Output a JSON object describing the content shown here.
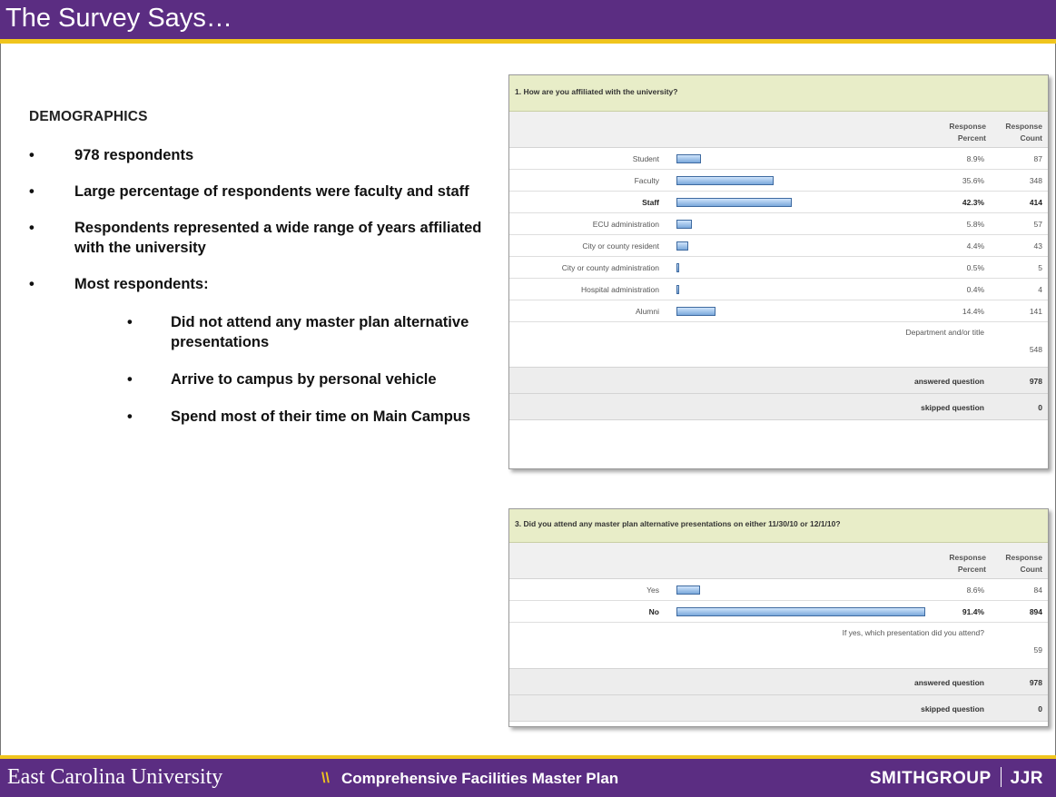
{
  "slide": {
    "title": "The Survey Says…"
  },
  "left": {
    "heading": "DEMOGRAPHICS",
    "bullets": [
      "978 respondents",
      "Large percentage of respondents were faculty and staff",
      "Respondents represented a wide range of years affiliated with the university",
      "Most respondents:"
    ],
    "sub_bullets": [
      "Did not attend any master plan alternative presentations",
      "Arrive to campus by personal vehicle",
      "Spend most of their time on Main Campus"
    ],
    "bullet_glyph": "•"
  },
  "survey1": {
    "question": "1. How are you affiliated with the university?",
    "col_percent_l1": "Response",
    "col_percent_l2": "Percent",
    "col_count_l1": "Response",
    "col_count_l2": "Count",
    "rows": [
      {
        "label": "Student",
        "percent": "8.9%",
        "count": "87"
      },
      {
        "label": "Faculty",
        "percent": "35.6%",
        "count": "348"
      },
      {
        "label": "Staff",
        "percent": "42.3%",
        "count": "414"
      },
      {
        "label": "ECU administration",
        "percent": "5.8%",
        "count": "57"
      },
      {
        "label": "City or county resident",
        "percent": "4.4%",
        "count": "43"
      },
      {
        "label": "City or county administration",
        "percent": "0.5%",
        "count": "5"
      },
      {
        "label": "Hospital administration",
        "percent": "0.4%",
        "count": "4"
      },
      {
        "label": "Alumni",
        "percent": "14.4%",
        "count": "141"
      }
    ],
    "text_label": "Department and/or title",
    "text_count": "548",
    "answered_label": "answered question",
    "answered_count": "978",
    "skipped_label": "skipped question",
    "skipped_count": "0"
  },
  "survey2": {
    "question": "3. Did you attend any master plan alternative presentations on either 11/30/10 or 12/1/10?",
    "col_percent_l1": "Response",
    "col_percent_l2": "Percent",
    "col_count_l1": "Response",
    "col_count_l2": "Count",
    "rows": [
      {
        "label": "Yes",
        "percent": "8.6%",
        "count": "84"
      },
      {
        "label": "No",
        "percent": "91.4%",
        "count": "894"
      }
    ],
    "text_label": "If yes, which presentation did you attend?",
    "text_count": "59",
    "answered_label": "answered question",
    "answered_count": "978",
    "skipped_label": "skipped question",
    "skipped_count": "0"
  },
  "footer": {
    "university": "East Carolina University",
    "separator": "\\\\",
    "plan": "Comprehensive Facilities Master Plan",
    "logo_left": "SMITHGROUP",
    "logo_right": "JJR"
  },
  "colors": {
    "title_bg": "#5b2d82",
    "accent_gold": "#f0c51d",
    "question_bg": "#e8edc8",
    "bar": "#7aa8db"
  }
}
